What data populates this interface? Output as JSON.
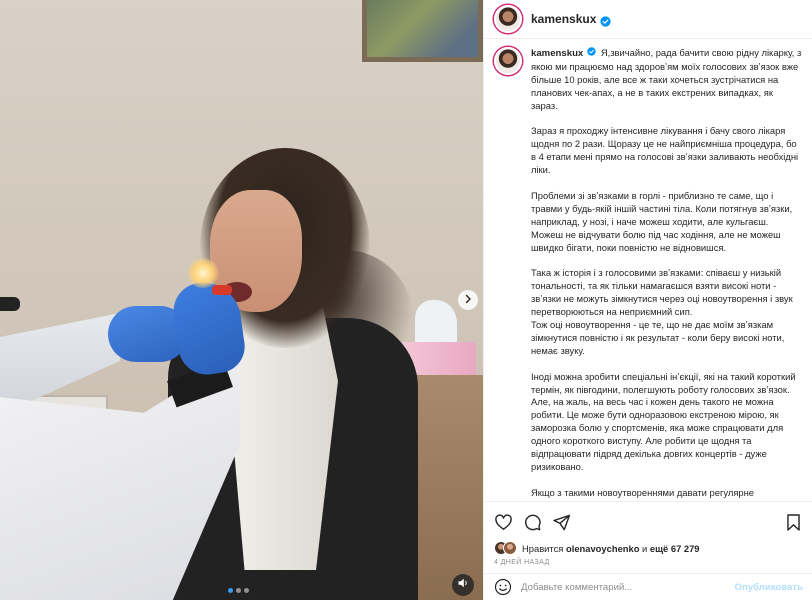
{
  "post": {
    "username": "kamenskux",
    "caption": {
      "username": "kamenskux",
      "paragraphs": [
        "Я,звичайно, рада бачити свою рідну лікарку, з якою ми працюємо над здоровʼям моїх голосових звʼязок вже більше 10 років, але все ж таки хочеться зустрічатися на планових чек-апах, а не в таких екстрених випадках, як зараз.",
        "Зараз я проходжу інтенсивне лікування і бачу свого лікаря щодня по 2 рази. Щоразу це не найприємніша процедура, бо в 4 етапи мені прямо на голосові звʼязки заливають необхідні ліки.",
        "Проблеми зі звʼязками в горлі - приблизно те саме, що і травми у будь-якій іншій частині тіла. Коли потягнув звʼязки, наприклад, у нозі, і наче можеш ходити, але кульгаєш. Можеш не відчувати болю під час ходіння, але не можеш швидко бігати, поки повністю не відновишся.",
        "Така ж історія і з голосовими звʼязками: співаєш у низькій тональності, та як тільки намагаєшся взяти високі ноти - звʼязки не можуть зімкнутися через оці новоутворення і звук перетворюються на неприємний сип.\nТож оці новоутворення - це те, що не дає моїм звʼязкам зімкнутися повністю і як результат - коли беру високі ноти, немає звуку.",
        "Іноді можна зробити спеціальні інʼєкції, які на такий короткий термін, як півгодини, полегшують роботу голосових звʼязок. Але, на жаль, на весь час і кожен день такого не можна робити. Це може бути одноразовою екстреною мірою, як заморозка болю у спортсменів, яка може спрацювати для одного короткого виступу. Але робити це щодня та відпрацювати підряд декілька довгих концертів - дуже ризиковано.",
        "Якщо з такими новоутвореннями давати регулярне навантаження та щодня співати живі концерти - звʼязки просто не матимуть часу та можливості відновитися і це неймовірний ризик для голосу 😔"
      ]
    },
    "likes": {
      "prefix": "Нравится ",
      "user": "olenavoychenko",
      "middle": " и ",
      "count_text": "ещё 67 279"
    },
    "time": "4 ДНЕЙ НАЗАД",
    "comment": {
      "placeholder": "Добавьте комментарий...",
      "publish_label": "Опубликовать"
    },
    "carousel": {
      "slides": 3,
      "active": 1
    },
    "icons": [
      "verified-badge-icon",
      "heart-icon",
      "comment-icon",
      "share-icon",
      "bookmark-icon",
      "emoji-icon",
      "chevron-right-icon",
      "sound-icon"
    ],
    "colors": {
      "accent": "#0095f6",
      "publish_disabled": "#b2dffc",
      "muted_text": "#8e8e8e"
    }
  }
}
